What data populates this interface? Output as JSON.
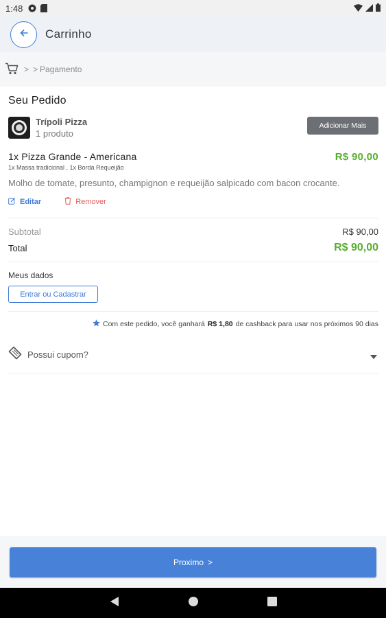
{
  "status_bar": {
    "time": "1:48"
  },
  "header": {
    "title": "Carrinho"
  },
  "breadcrumb": {
    "sep1": ">",
    "sep2": ">",
    "current": "Pagamento"
  },
  "order": {
    "section_title": "Seu Pedido",
    "store_name": "Trípoli Pizza",
    "product_count": "1 produto",
    "add_more_label": "Adicionar Mais",
    "item": {
      "name": "1x Pizza Grande - Americana",
      "options": "1x Massa tradicional , 1x Borda Requeijão",
      "price": "R$ 90,00",
      "description": "Molho de tomate, presunto, champignon e requeijão salpicado com bacon crocante.",
      "edit_label": "Editar",
      "remove_label": "Remover"
    }
  },
  "totals": {
    "subtotal_label": "Subtotal",
    "subtotal_value": "R$ 90,00",
    "total_label": "Total",
    "total_value": "R$ 90,00"
  },
  "my_data": {
    "label": "Meus dados",
    "login_label": "Entrar ou Cadastrar"
  },
  "cashback": {
    "before": "Com este pedido, você ganhará",
    "amount": "R$ 1,80",
    "after": "de cashback para usar nos próximos 90 dias"
  },
  "coupon": {
    "label": "Possui cupom?"
  },
  "footer": {
    "next_label": "Proximo",
    "next_arrow": ">"
  },
  "colors": {
    "accent": "#4781d8",
    "price": "#56ad2e",
    "danger": "#e05a5a"
  }
}
